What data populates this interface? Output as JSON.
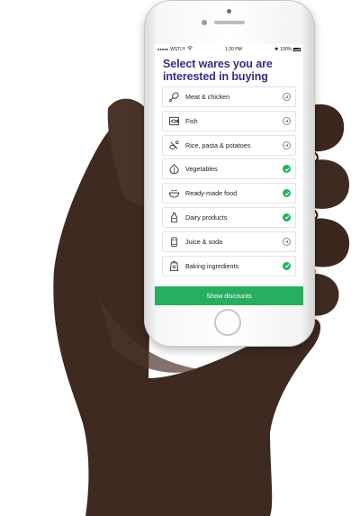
{
  "status_bar": {
    "signal_dots": "●●●●●",
    "carrier": "WSTLY",
    "time": "1:20 PM",
    "bluetooth": "✱",
    "battery": "100%"
  },
  "header": {
    "title": "Select wares you are interested in buying"
  },
  "items": [
    {
      "label": "Meat & chicken",
      "icon": "drumstick-icon",
      "selected": false
    },
    {
      "label": "Fish",
      "icon": "fish-icon",
      "selected": false
    },
    {
      "label": "Rice, pasta & potatoes",
      "icon": "rice-icon",
      "selected": false
    },
    {
      "label": "Vegetables",
      "icon": "garlic-icon",
      "selected": true
    },
    {
      "label": "Ready-made food",
      "icon": "bowl-icon",
      "selected": true
    },
    {
      "label": "Dairy products",
      "icon": "milk-bottle-icon",
      "selected": true
    },
    {
      "label": "Juice & soda",
      "icon": "can-icon",
      "selected": false
    },
    {
      "label": "Baking ingredients",
      "icon": "flour-bag-icon",
      "selected": true
    }
  ],
  "cta": {
    "label": "Show discounts"
  },
  "colors": {
    "title": "#3d2a82",
    "accent": "#27ae60",
    "skin": "#3e2a20"
  }
}
